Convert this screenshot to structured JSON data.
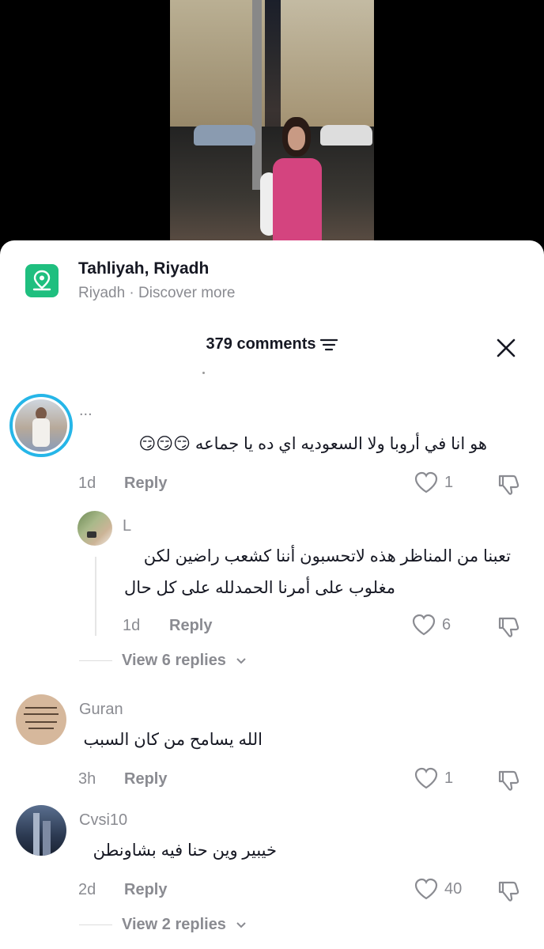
{
  "location": {
    "title": "Tahliyah, Riyadh",
    "subtitle": "Riyadh · Discover more"
  },
  "comments_header": {
    "count_label": "379 comments"
  },
  "comments": [
    {
      "username": "...",
      "text": "هو انا في أروبا ولا السعوديه اي ده يا جماعه 😏😏😏",
      "time": "1d",
      "reply_label": "Reply",
      "likes": "1",
      "replies": [
        {
          "username": "L",
          "text_line1": "تعبنا من المناظر هذه لاتحسبون أننا كشعب راضين لكن",
          "text_line2": "مغلوب على أمرنا الحمدلله على كل حال",
          "time": "1d",
          "reply_label": "Reply",
          "likes": "6"
        }
      ],
      "view_replies": "View 6 replies"
    },
    {
      "username": "Guran",
      "text": "الله يسامح من كان السبب",
      "time": "3h",
      "reply_label": "Reply",
      "likes": "1"
    },
    {
      "username": "Cvsi10",
      "text": "خيبير وين حنا فيه بشاونطن",
      "time": "2d",
      "reply_label": "Reply",
      "likes": "40",
      "view_replies": "View 2 replies"
    }
  ],
  "icons": {
    "location": "map-pin-icon",
    "sort": "sort-lines-icon",
    "close": "close-icon",
    "like": "heart-outline-icon",
    "dislike": "thumbs-down-icon",
    "chevron": "chevron-down-icon"
  },
  "colors": {
    "location_icon_bg": "#1fbf7f",
    "story_ring": "#26b6e8",
    "muted_text": "#8a8b91",
    "primary_text": "#161823"
  }
}
